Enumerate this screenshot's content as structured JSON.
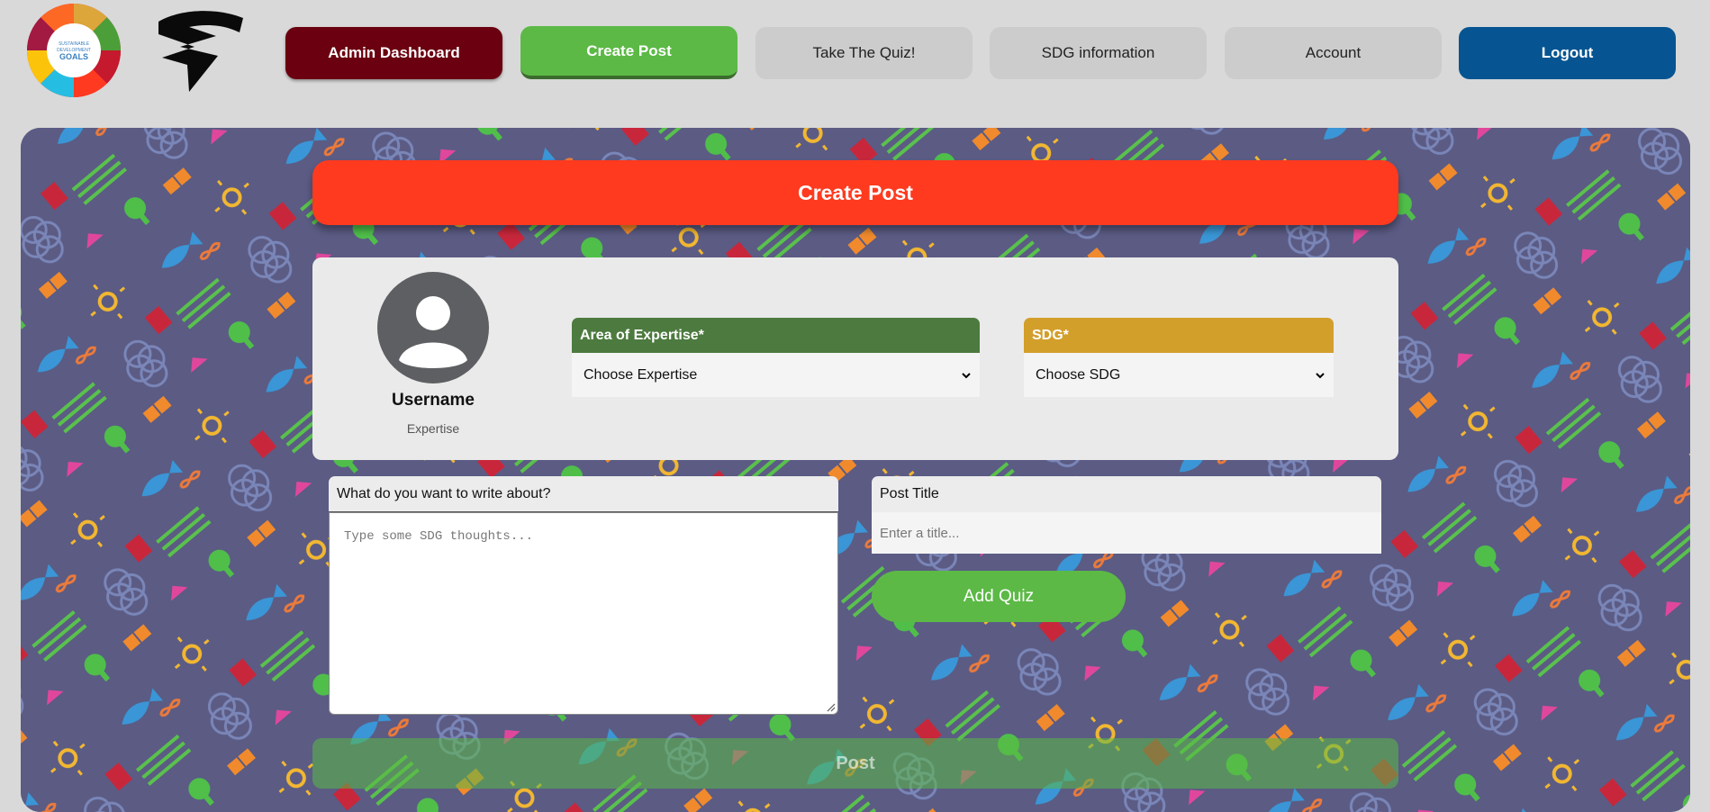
{
  "nav": {
    "admin_dashboard": "Admin Dashboard",
    "create_post": "Create Post",
    "take_quiz": "Take The Quiz!",
    "sdg_information": "SDG information",
    "account": "Account",
    "logout": "Logout"
  },
  "logos": {
    "sdg_logo_text": "SUSTAINABLE DEVELOPMENT GOALS",
    "sdg_logo_icon": "sdg-wheel-logo",
    "brand_logo_icon": "brand-logo"
  },
  "banner": {
    "title": "Create Post"
  },
  "profile": {
    "username": "Username",
    "expertise": "Expertise",
    "avatar_icon": "user-avatar-icon"
  },
  "expertise_field": {
    "label": "Area of Expertise*",
    "selected": "Choose Expertise"
  },
  "sdg_field": {
    "label": "SDG*",
    "selected": "Choose SDG"
  },
  "write": {
    "label": "What do you want to write about?",
    "placeholder": "Type some SDG thoughts..."
  },
  "post_title": {
    "label": "Post Title",
    "placeholder": "Enter a title..."
  },
  "add_quiz": {
    "label": "Add Quiz"
  },
  "post": {
    "label": "Post"
  },
  "colors": {
    "admin": "#6b0010",
    "create": "#5cb946",
    "logout": "#065592",
    "banner": "#ff3a1f",
    "expertise_head": "#4c7a3f",
    "sdg_head": "#d39f2b"
  }
}
